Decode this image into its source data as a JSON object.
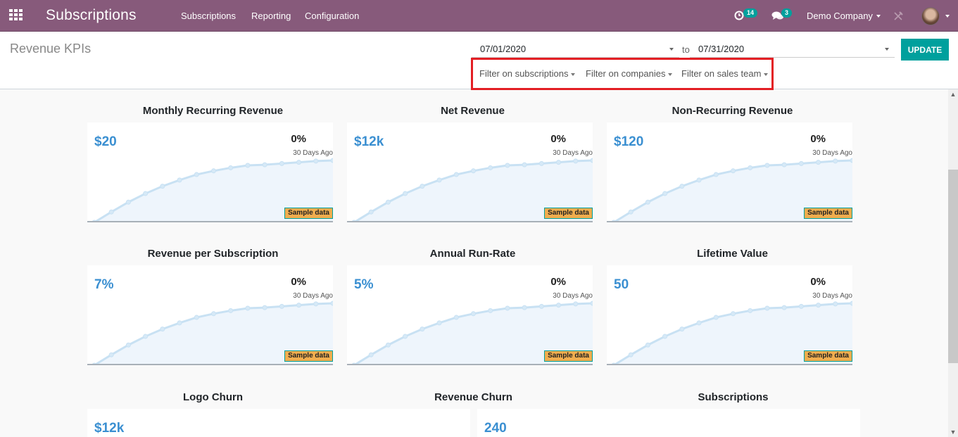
{
  "navbar": {
    "apps_icon": "apps-grid-icon",
    "brand": "Subscriptions",
    "menu": [
      "Subscriptions",
      "Reporting",
      "Configuration"
    ],
    "activity_badge": "14",
    "messages_badge": "3",
    "company": "Demo Company",
    "colors": {
      "navbar": "#875a7b",
      "badge": "#00a09d"
    }
  },
  "control_panel": {
    "title": "Revenue KPIs",
    "date_from": "07/01/2020",
    "to_label": "to",
    "date_to": "07/31/2020",
    "update_label": "UPDATE",
    "filters": [
      "Filter on subscriptions",
      "Filter on companies",
      "Filter on sales team"
    ],
    "highlight_color": "#e31e24"
  },
  "kpis": [
    {
      "title": "Monthly Recurring Revenue",
      "value": "$20",
      "trend": "0%",
      "sub": "30 Days Ago",
      "badge": "Sample data"
    },
    {
      "title": "Net Revenue",
      "value": "$12k",
      "trend": "0%",
      "sub": "30 Days Ago",
      "badge": "Sample data"
    },
    {
      "title": "Non-Recurring Revenue",
      "value": "$120",
      "trend": "0%",
      "sub": "30 Days Ago",
      "badge": "Sample data"
    },
    {
      "title": "Revenue per Subscription",
      "value": "7%",
      "trend": "0%",
      "sub": "30 Days Ago",
      "badge": "Sample data"
    },
    {
      "title": "Annual Run-Rate",
      "value": "5%",
      "trend": "0%",
      "sub": "30 Days Ago",
      "badge": "Sample data"
    },
    {
      "title": "Lifetime Value",
      "value": "50",
      "trend": "0%",
      "sub": "30 Days Ago",
      "badge": "Sample data"
    }
  ],
  "bottom_kpis": [
    {
      "title": "Logo Churn",
      "value": "$12k"
    },
    {
      "title": "Revenue Churn",
      "value": "240"
    },
    {
      "title": "Subscriptions",
      "value": ""
    }
  ],
  "sparkline": {
    "values": [
      0,
      17,
      33,
      47,
      59,
      69,
      78,
      84,
      89,
      93,
      94,
      96,
      98,
      100,
      101
    ],
    "max": 101,
    "line_color": "#c8e1f3",
    "fill_color": "#eef5fc"
  }
}
